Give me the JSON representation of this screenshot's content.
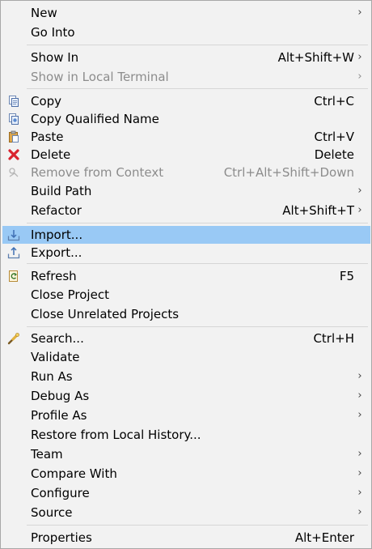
{
  "menu": {
    "items": [
      {
        "label": "New",
        "submenu": true
      },
      {
        "label": "Go Into"
      },
      {
        "label": "Show In",
        "shortcut": "Alt+Shift+W",
        "submenu": true
      },
      {
        "label": "Show in Local Terminal",
        "submenu": true,
        "disabled": true
      },
      {
        "label": "Copy",
        "shortcut": "Ctrl+C",
        "icon": "copy-icon"
      },
      {
        "label": "Copy Qualified Name",
        "icon": "copy-qualified-name-icon"
      },
      {
        "label": "Paste",
        "shortcut": "Ctrl+V",
        "icon": "paste-icon"
      },
      {
        "label": "Delete",
        "shortcut": "Delete",
        "icon": "delete-icon"
      },
      {
        "label": "Remove from Context",
        "shortcut": "Ctrl+Alt+Shift+Down",
        "icon": "remove-from-context-icon",
        "disabled": true
      },
      {
        "label": "Build Path",
        "submenu": true
      },
      {
        "label": "Refactor",
        "shortcut": "Alt+Shift+T",
        "submenu": true
      },
      {
        "label": "Import...",
        "icon": "import-icon",
        "selected": true
      },
      {
        "label": "Export...",
        "icon": "export-icon"
      },
      {
        "label": "Refresh",
        "shortcut": "F5",
        "icon": "refresh-icon"
      },
      {
        "label": "Close Project"
      },
      {
        "label": "Close Unrelated Projects"
      },
      {
        "label": "Search...",
        "shortcut": "Ctrl+H",
        "icon": "search-icon"
      },
      {
        "label": "Validate"
      },
      {
        "label": "Run As",
        "submenu": true
      },
      {
        "label": "Debug As",
        "submenu": true
      },
      {
        "label": "Profile As",
        "submenu": true
      },
      {
        "label": "Restore from Local History..."
      },
      {
        "label": "Team",
        "submenu": true
      },
      {
        "label": "Compare With",
        "submenu": true
      },
      {
        "label": "Configure",
        "submenu": true
      },
      {
        "label": "Source",
        "submenu": true
      },
      {
        "label": "Properties",
        "shortcut": "Alt+Enter"
      }
    ],
    "arrow_glyph": "›",
    "colors": {
      "selection": "#99c9f5",
      "disabled_text": "#8c8c8c",
      "delete_icon": "#d9232e"
    }
  }
}
